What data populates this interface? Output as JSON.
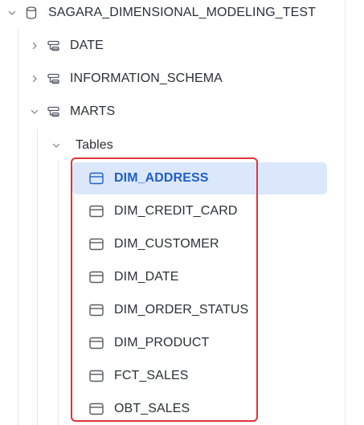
{
  "database": {
    "name": "SAGARA_DIMENSIONAL_MODELING_TEST",
    "icon": "database-icon",
    "expanded": true
  },
  "schemas": [
    {
      "name": "DATE",
      "icon": "schema-icon",
      "expanded": false
    },
    {
      "name": "INFORMATION_SCHEMA",
      "icon": "schema-icon",
      "expanded": false
    },
    {
      "name": "MARTS",
      "icon": "schema-icon",
      "expanded": true
    }
  ],
  "folder": {
    "name": "Tables",
    "expanded": true
  },
  "tables": [
    {
      "name": "DIM_ADDRESS",
      "icon": "table-icon",
      "selected": true
    },
    {
      "name": "DIM_CREDIT_CARD",
      "icon": "table-icon"
    },
    {
      "name": "DIM_CUSTOMER",
      "icon": "table-icon"
    },
    {
      "name": "DIM_DATE",
      "icon": "table-icon"
    },
    {
      "name": "DIM_ORDER_STATUS",
      "icon": "table-icon"
    },
    {
      "name": "DIM_PRODUCT",
      "icon": "table-icon"
    },
    {
      "name": "FCT_SALES",
      "icon": "table-icon"
    },
    {
      "name": "OBT_SALES",
      "icon": "table-icon"
    }
  ],
  "colors": {
    "selected_bg": "#dbe7fb",
    "selected_text": "#1f5fc8",
    "highlight_border": "#e0343a",
    "text": "#2b2f36"
  }
}
